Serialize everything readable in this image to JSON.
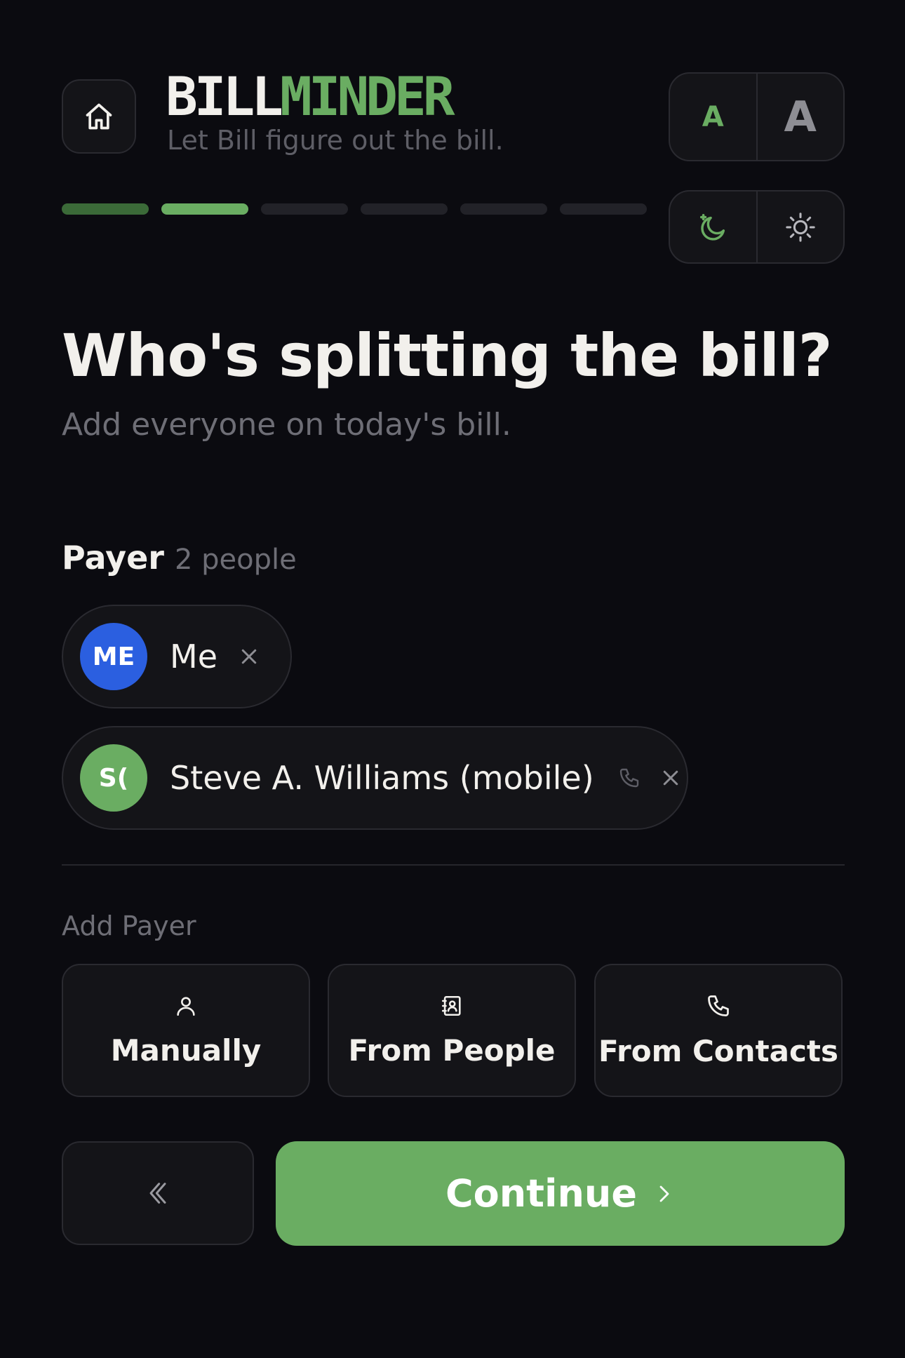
{
  "app": {
    "logo_part1": "BILL",
    "logo_part2": "MINDER",
    "tagline": "Let Bill figure out the bill."
  },
  "header": {
    "home_icon": "home-icon",
    "font_small_label": "A",
    "font_large_label": "A",
    "dark_icon": "moon-stars-icon",
    "light_icon": "sun-icon"
  },
  "progress": {
    "total_steps": 6,
    "current_step": 2,
    "colors": {
      "done": "#3b6a38",
      "current": "#6aad62",
      "todo": "#222228"
    }
  },
  "main": {
    "title": "Who's splitting the bill?",
    "subtitle": "Add everyone on today's bill."
  },
  "payers": {
    "label": "Payer",
    "count": "2 people",
    "items": [
      {
        "initials": "ME",
        "name": "Me",
        "color": "#2b5fe0",
        "phone": false
      },
      {
        "initials": "S(",
        "name": "Steve A. Williams (mobile)",
        "color": "#6aad62",
        "phone": true
      }
    ]
  },
  "add_payer": {
    "label": "Add Payer",
    "options": [
      {
        "label": "Manually",
        "icon": "person-icon"
      },
      {
        "label": "From People",
        "icon": "contact-book-icon"
      },
      {
        "label": "From Contacts",
        "icon": "phone-icon"
      }
    ]
  },
  "footer": {
    "back_icon": "double-chevron-left-icon",
    "continue_label": "Continue",
    "accent": "#6aad62"
  }
}
